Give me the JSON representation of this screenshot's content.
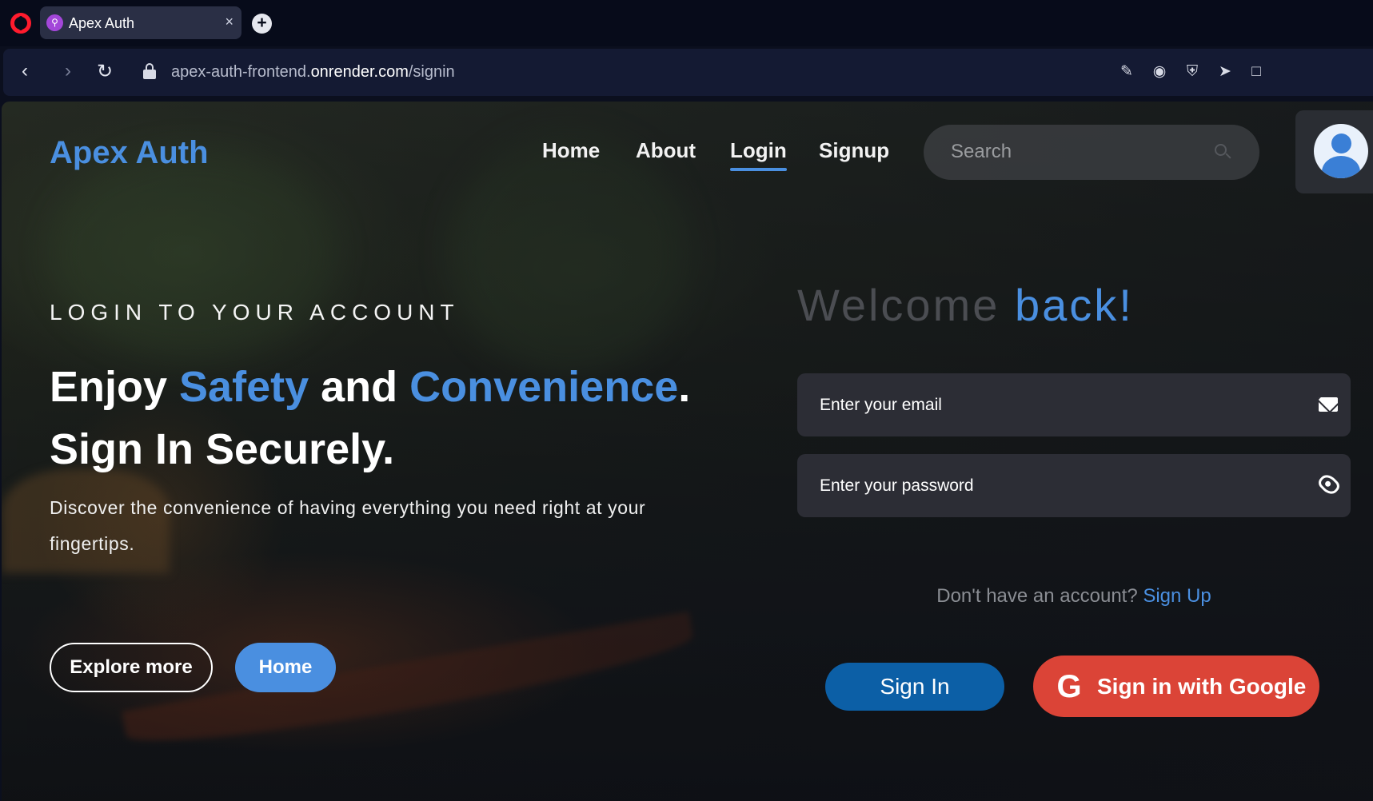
{
  "browser": {
    "tab_title": "Apex Auth",
    "tab_close": "×",
    "new_tab": "+",
    "url_prefix": "apex-auth-frontend.",
    "url_host": "onrender.com",
    "url_path": "/signin",
    "icons": [
      "opera-logo-icon",
      "back-icon",
      "forward-icon",
      "reload-icon",
      "lock-icon",
      "edit-icon",
      "camera-icon",
      "shield-icon",
      "send-icon",
      "wallet-icon"
    ]
  },
  "navbar": {
    "logo": "Apex Auth",
    "links": [
      {
        "label": "Home",
        "active": false
      },
      {
        "label": "About",
        "active": false
      },
      {
        "label": "Login",
        "active": true
      },
      {
        "label": "Signup",
        "active": false
      }
    ],
    "search_placeholder": "Search"
  },
  "hero": {
    "eyebrow": "LOGIN TO YOUR ACCOUNT",
    "headline_1": "Enjoy ",
    "headline_accent_1": "Safety",
    "headline_2": " and ",
    "headline_accent_2": "Convenience",
    "headline_3": ".",
    "headline_line2": "Sign In Securely.",
    "subtext": "Discover the convenience of having everything you need right at your fingertips.",
    "explore_label": "Explore more",
    "home_label": "Home"
  },
  "login": {
    "welcome": "Welcome ",
    "welcome_accent": "back!",
    "email_placeholder": "Enter your email",
    "password_placeholder": "Enter your password",
    "signup_prompt": "Don't have an account? ",
    "signup_link": "Sign Up",
    "signin_label": "Sign In",
    "google_label": "Sign in with Google"
  },
  "colors": {
    "accent": "#4a8fe0",
    "signin_button": "#0c5fa6",
    "google_button": "#db4437"
  }
}
